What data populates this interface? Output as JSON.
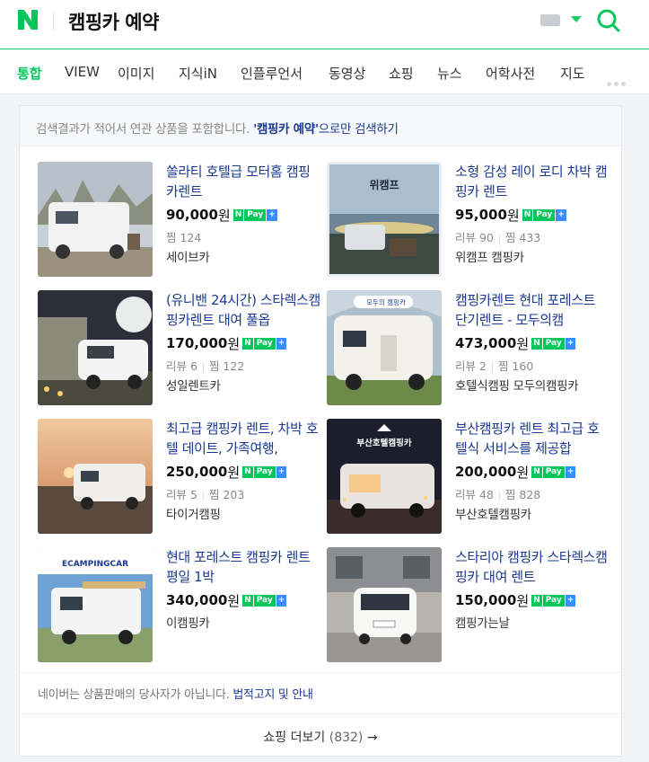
{
  "header": {
    "logo_text": "N",
    "query": "캠핑카 예약",
    "brand_color": "#03c75a"
  },
  "tabs": [
    {
      "label": "통합",
      "active": true
    },
    {
      "label": "VIEW"
    },
    {
      "label": "이미지"
    },
    {
      "label": "지식iN"
    },
    {
      "label": "인플루언서"
    },
    {
      "label": "동영상"
    },
    {
      "label": "쇼핑"
    },
    {
      "label": "뉴스"
    },
    {
      "label": "어학사전"
    },
    {
      "label": "지도"
    }
  ],
  "notice": {
    "prefix": "검색결과가 적어서 연관 상품을 포함합니다. ",
    "quoted": "'캠핑카 예약'",
    "suffix": "으로만 ",
    "link": "검색하기"
  },
  "products": [
    {
      "title": "쏠라티 호텔급 모터홈 캠핑카렌트",
      "price": "90,000",
      "won": "원",
      "meta": [
        "찜 124"
      ],
      "store": "세이브카",
      "npay": true
    },
    {
      "title": "소형 감성 레이 로디 차박 캠핑카 렌트",
      "price": "95,000",
      "won": "원",
      "meta": [
        "리뷰 90",
        "찜 433"
      ],
      "store": "위캠프 캠핑카",
      "npay": true,
      "thumb_label": "위캠프"
    },
    {
      "title": "(유니밴 24시간) 스타렉스캠핑카렌트 대여 풀옵",
      "price": "170,000",
      "won": "원",
      "meta": [
        "리뷰 6",
        "찜 122"
      ],
      "store": "성일렌트카",
      "npay": true
    },
    {
      "title": "캠핑카렌트 현대 포레스트 단기렌트 - 모두의캠",
      "price": "473,000",
      "won": "원",
      "meta": [
        "리뷰 2",
        "찜 160"
      ],
      "store": "호텔식캠핑 모두의캠핑카",
      "npay": true,
      "thumb_label": "모두의 캠핑카"
    },
    {
      "title": "최고급 캠핑카 렌트, 차박 호텔 데이트, 가족여행,",
      "price": "250,000",
      "won": "원",
      "meta": [
        "리뷰 5",
        "찜 203"
      ],
      "store": "타이거캠핑",
      "npay": true
    },
    {
      "title": "부산캠핑카 렌트 최고급 호텔식 서비스를 제공합",
      "price": "200,000",
      "won": "원",
      "meta": [
        "리뷰 48",
        "찜 828"
      ],
      "store": "부산호텔캠핑카",
      "npay": true,
      "thumb_label": "부산호텔캠핑카"
    },
    {
      "title": "현대 포레스트 캠핑카 렌트 평일 1박",
      "price": "340,000",
      "won": "원",
      "meta": [],
      "store": "이캠핑카",
      "npay": true,
      "thumb_label": "ECAMPINGCAR"
    },
    {
      "title": "스타리아 캠핑카 스타렉스캠핑카 대여 렌트",
      "price": "150,000",
      "won": "원",
      "meta": [],
      "store": "캠핑가는날",
      "npay": true
    }
  ],
  "npay": {
    "n": "N",
    "pay": "Pay",
    "plus": "+"
  },
  "footer": {
    "text": "네이버는 상품판매의 당사자가 아닙니다. ",
    "link": "법적고지 및 안내",
    "more_label": "쇼핑 더보기",
    "more_count": "(832)",
    "arrow": "→"
  }
}
